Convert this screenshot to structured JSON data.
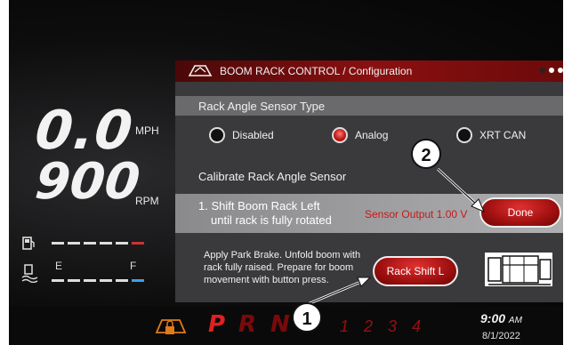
{
  "dashboard": {
    "speed_value": "0.0",
    "speed_unit": "MPH",
    "rpm_value": "900",
    "rpm_unit": "RPM",
    "fuel_icon": "fuel-pump-icon",
    "def_icon": "def-fluid-icon",
    "gauge_empty": "E",
    "gauge_full": "F"
  },
  "panel": {
    "title": "BOOM RACK CONTROL / Configuration",
    "sensor_type_heading": "Rack Angle Sensor Type",
    "options": [
      {
        "label": "Disabled",
        "selected": false
      },
      {
        "label": "Analog",
        "selected": true
      },
      {
        "label": "XRT CAN",
        "selected": false
      }
    ],
    "calibrate_heading": "Calibrate Rack Angle Sensor",
    "step_line1": "1. Shift Boom Rack Left",
    "step_line2": "until rack is fully rotated",
    "sensor_output": "Sensor Output 1.00 V",
    "done_label": "Done",
    "info_line1": "Apply Park Brake.  Unfold boom with",
    "info_line2": "rack fully raised.  Prepare for boom",
    "info_line3": "movement with button press.",
    "rack_shift_label": "Rack Shift L"
  },
  "callouts": [
    "1",
    "2"
  ],
  "status_bar": {
    "gear_p": "P",
    "gear_r": "R",
    "gear_n": "N",
    "gears_fwd": "1 2 3 4",
    "time": "9:00",
    "ampm": "AM",
    "date": "8/1/2022"
  },
  "colors": {
    "accent_red": "#c21818",
    "header_red": "#8a1010",
    "gear_orange": "#e07a1a",
    "def_blue": "#3aa0e8"
  }
}
